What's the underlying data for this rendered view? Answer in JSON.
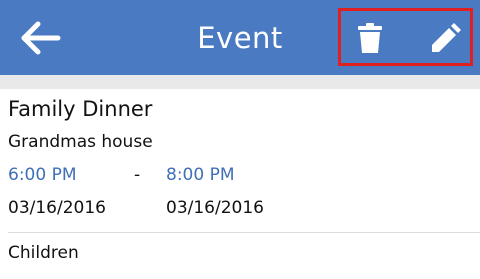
{
  "header": {
    "title": "Event",
    "background_color": "#4a7ac2",
    "back_icon": "arrow-left-icon",
    "delete_icon": "trash-icon",
    "edit_icon": "pencil-icon",
    "highlight_color": "#e02020"
  },
  "event": {
    "name": "Family Dinner",
    "location": "Grandmas house",
    "start_time": "6:00 PM",
    "separator": "-",
    "end_time": "8:00 PM",
    "start_date": "03/16/2016",
    "end_date": "03/16/2016",
    "time_color": "#3f6fb8"
  },
  "section": {
    "label": "Children"
  }
}
